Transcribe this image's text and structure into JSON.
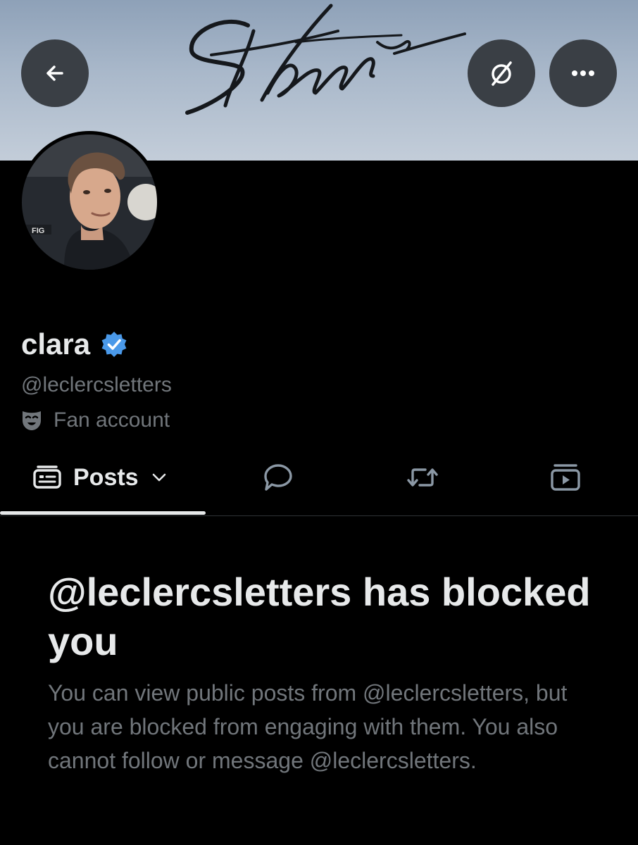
{
  "header": {
    "back_icon": "arrow-left-icon",
    "grok_icon": "grok-slash-circle-icon",
    "more_icon": "more-horizontal-icon",
    "banner_description_colors": {
      "top": "#8ea1b8",
      "bottom": "#c3cdd9"
    }
  },
  "profile": {
    "display_name": "clara",
    "verified_icon": "verified-badge-icon",
    "verified_color": "#4a99e9",
    "handle": "@leclercsletters",
    "category_icon": "theater-mask-icon",
    "category": "Fan account"
  },
  "tabs": {
    "posts_icon": "posts-card-icon",
    "posts_label": "Posts",
    "dropdown_icon": "chevron-down-icon",
    "replies_icon": "speech-bubble-icon",
    "reposts_icon": "repost-arrows-icon",
    "videos_icon": "video-stack-icon"
  },
  "blocked": {
    "title": "@leclercsletters has blocked you",
    "description": "You can view public posts from @leclercsletters, but you are blocked from engaging with them. You also cannot follow or message @leclercsletters."
  },
  "colors": {
    "background": "#000000",
    "primary_text": "#e7e9ea",
    "secondary_text": "#71767b",
    "button_bg": "#3a3f45"
  }
}
